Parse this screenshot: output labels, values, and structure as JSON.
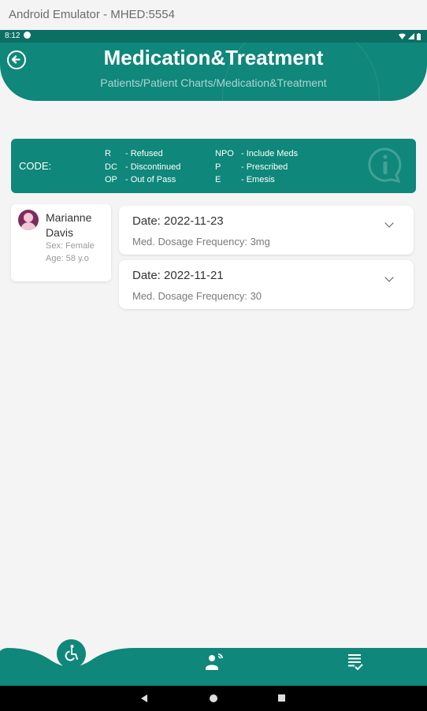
{
  "window": {
    "title": "Android Emulator - MHED:5554"
  },
  "status_bar": {
    "time": "8:12"
  },
  "header": {
    "title": "Medication&Treatment",
    "breadcrumb": "Patients/Patient Charts/Medication&Treatment"
  },
  "codes": {
    "label": "CODE:",
    "items": [
      {
        "code": "R",
        "meaning": "- Refused"
      },
      {
        "code": "DC",
        "meaning": "- Discontinued"
      },
      {
        "code": "OP",
        "meaning": "- Out of Pass"
      },
      {
        "code": "NPO",
        "meaning": "- Include Meds"
      },
      {
        "code": "P",
        "meaning": "- Prescribed"
      },
      {
        "code": "E",
        "meaning": "- Emesis"
      }
    ]
  },
  "patient": {
    "name": "Marianne Davis",
    "sex": "Sex: Female",
    "age": "Age: 58 y.o"
  },
  "entries": [
    {
      "date": "Date: 2022-11-23",
      "detail": "Med. Dosage Frequency: 3mg"
    },
    {
      "date": "Date: 2022-11-21",
      "detail": "Med. Dosage Frequency: 30"
    }
  ],
  "bottom_nav": {
    "items": [
      {
        "icon": "wheelchair-icon",
        "active": true
      },
      {
        "icon": "patient-phone-icon",
        "active": false
      },
      {
        "icon": "checklist-icon",
        "active": false
      }
    ]
  },
  "colors": {
    "primary": "#0f877a",
    "status_bar": "#0c6f63",
    "background": "#f4f4f4"
  }
}
